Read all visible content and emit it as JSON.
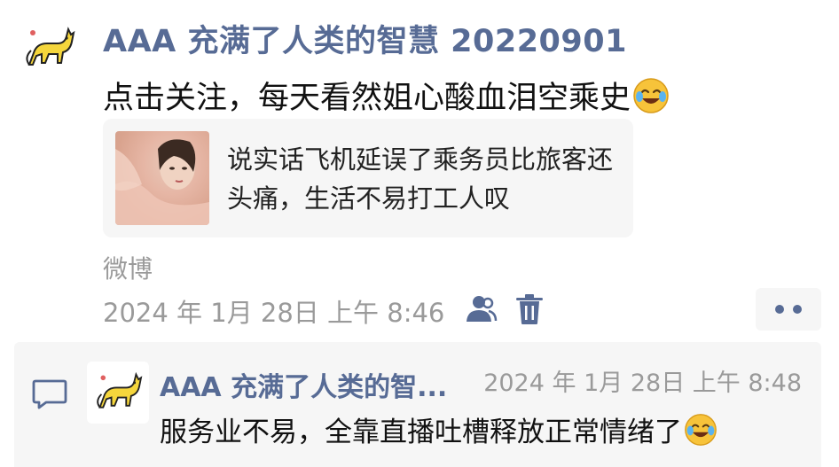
{
  "post": {
    "author": "AAA 充满了人类的智慧 20220901",
    "text": "点击关注，每天看然姐心酸血泪空乘史",
    "text_emoji": "face-with-tears-of-joy",
    "link_card": {
      "title": "说实话飞机延误了乘务员比旅客还头痛，生活不易打工人叹"
    },
    "source": "微博",
    "time": "2024 年 1月 28日 上午 8:46",
    "icons": {
      "visibility": "people-icon",
      "delete": "trash-icon",
      "more": "more-icon"
    }
  },
  "comment": {
    "author": "AAA 充满了人类的智...",
    "time": "2024 年 1月 28日 上午 8:48",
    "text": "服务业不易，全靠直播吐槽释放正常情绪了",
    "text_emoji": "face-with-tears-of-joy"
  },
  "colors": {
    "link_blue": "#576b95",
    "meta_gray": "#9a9a9a",
    "card_bg": "#f6f6f6"
  }
}
